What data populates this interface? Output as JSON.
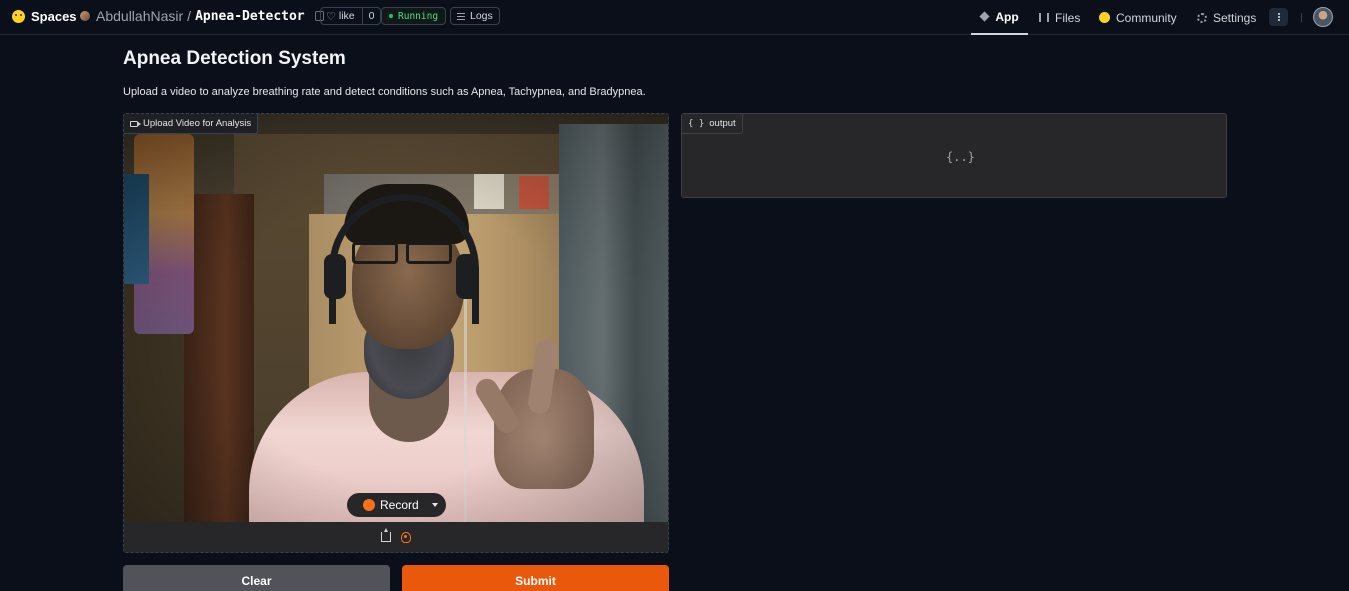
{
  "topbar": {
    "brand": "Spaces",
    "owner": "AbdullahNasir",
    "separator": "/",
    "repo": "Apnea-Detector",
    "like_label": "like",
    "like_count": "0",
    "status": "Running",
    "logs_label": "Logs",
    "nav": [
      {
        "label": "App",
        "icon": "cube-icon",
        "active": true
      },
      {
        "label": "Files",
        "icon": "files-icon"
      },
      {
        "label": "Community",
        "icon": "community-icon"
      },
      {
        "label": "Settings",
        "icon": "gear-icon"
      }
    ]
  },
  "main": {
    "title": "Apnea Detection System",
    "description": "Upload a video to analyze breathing rate and detect conditions such as Apnea, Tachypnea, and Bradypnea.",
    "video_input": {
      "label": "Upload Video for Analysis",
      "record_label": "Record"
    },
    "output": {
      "label": "output",
      "label_icon": "{ }",
      "placeholder": "{..}"
    },
    "buttons": {
      "clear": "Clear",
      "submit": "Submit"
    }
  },
  "colors": {
    "background": "#0b0f19",
    "panel": "#27272a",
    "accent": "#ea580c",
    "running": "#4ade80"
  }
}
